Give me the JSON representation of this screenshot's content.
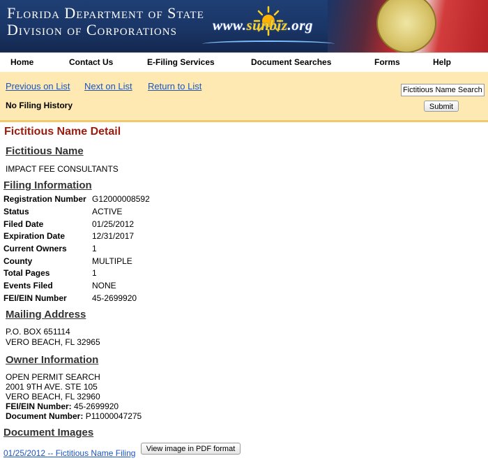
{
  "header": {
    "line1": "Florida Department of State",
    "line2": "Division of Corporations",
    "logo_prefix": "www.",
    "logo_brand": "sunbiz",
    "logo_suffix": ".org"
  },
  "nav": {
    "items": [
      "Home",
      "Contact Us",
      "E-Filing Services",
      "Document Searches",
      "Forms",
      "Help"
    ]
  },
  "toolbar": {
    "prev": "Previous on List",
    "next": "Next on List",
    "return": "Return to List",
    "no_history": "No Filing History",
    "search_value": "Fictitious Name Search",
    "submit": "Submit"
  },
  "page_title": "Fictitious Name Detail",
  "fictitious_name": {
    "heading": "Fictitious Name",
    "value": "IMPACT FEE CONSULTANTS"
  },
  "filing": {
    "heading": "Filing Information",
    "rows": [
      {
        "label": "Registration Number",
        "value": "G12000008592"
      },
      {
        "label": "Status",
        "value": "ACTIVE"
      },
      {
        "label": "Filed Date",
        "value": "01/25/2012"
      },
      {
        "label": "Expiration Date",
        "value": "12/31/2017"
      },
      {
        "label": "Current Owners",
        "value": "1"
      },
      {
        "label": "County",
        "value": "MULTIPLE"
      },
      {
        "label": "Total Pages",
        "value": "1"
      },
      {
        "label": "Events Filed",
        "value": "NONE"
      },
      {
        "label": "FEI/EIN Number",
        "value": "45-2699920"
      }
    ]
  },
  "mailing": {
    "heading": "Mailing Address",
    "line1": "P.O. BOX 651114",
    "line2": "VERO BEACH, FL 32965"
  },
  "owner": {
    "heading": "Owner Information",
    "name": "OPEN PERMIT SEARCH",
    "street": "2001 9TH AVE. STE 105",
    "city": "VERO BEACH, FL 32960",
    "fei_label": "FEI/EIN Number:",
    "fei_value": "45-2699920",
    "doc_label": "Document Number:",
    "doc_value": "P11000047275"
  },
  "images": {
    "heading": "Document Images",
    "link": "01/25/2012 -- Fictitious Name Filing",
    "button": "View image in PDF format"
  }
}
